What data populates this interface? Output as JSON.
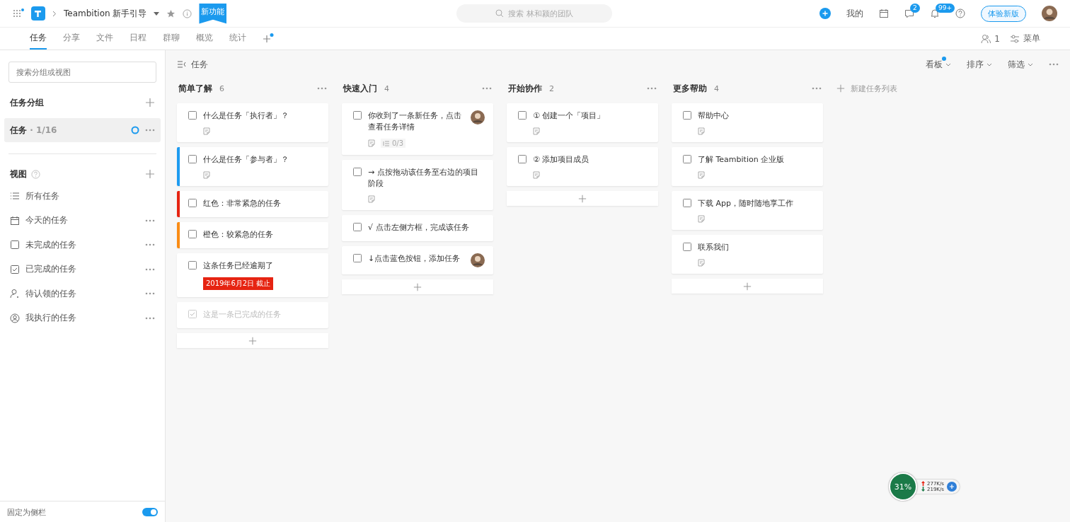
{
  "header": {
    "project_title": "Teambition 新手引导",
    "new_feature_badge": "新功能",
    "search_placeholder": "搜索 林和颍的团队",
    "mine_label": "我的",
    "chat_badge": "2",
    "notice_badge": "99+",
    "try_new_label": "体验新版"
  },
  "tabs": [
    {
      "label": "任务",
      "selected": true
    },
    {
      "label": "分享",
      "selected": false
    },
    {
      "label": "文件",
      "selected": false
    },
    {
      "label": "日程",
      "selected": false
    },
    {
      "label": "群聊",
      "selected": false
    },
    {
      "label": "概览",
      "selected": false
    },
    {
      "label": "统计",
      "selected": false
    }
  ],
  "members_count": "1",
  "menu_label": "菜单",
  "sidebar": {
    "search_placeholder": "搜索分组或视图",
    "groups_title": "任务分组",
    "groups": [
      {
        "label": "任务",
        "count": "· 1/16",
        "selected": true
      }
    ],
    "views_title": "视图",
    "views": [
      {
        "kind": "list",
        "label": "所有任务",
        "more": false
      },
      {
        "kind": "calendar",
        "label": "今天的任务",
        "more": true
      },
      {
        "kind": "box",
        "label": "未完成的任务",
        "more": true
      },
      {
        "kind": "checked",
        "label": "已完成的任务",
        "more": true
      },
      {
        "kind": "person",
        "label": "待认领的任务",
        "more": true
      },
      {
        "kind": "user",
        "label": "我执行的任务",
        "more": true
      }
    ],
    "pin_label": "固定为侧栏",
    "pin_on": true
  },
  "toolbar": {
    "breadcrumb": "任务",
    "options": [
      {
        "label": "看板",
        "dot": true
      },
      {
        "label": "排序",
        "dot": false
      },
      {
        "label": "筛选",
        "dot": false
      }
    ]
  },
  "columns": [
    {
      "title": "简单了解",
      "count": "6",
      "cards": [
        {
          "title": "什么是任务「执行者」？",
          "checked": false,
          "note": true,
          "avatar": false
        },
        {
          "title": "什么是任务「参与者」？",
          "color": "#1e9bf0",
          "checked": false,
          "note": true,
          "avatar": false
        },
        {
          "title": "红色：非常紧急的任务",
          "color": "#e62412",
          "checked": false,
          "note": false,
          "avatar": false
        },
        {
          "title": "橙色：较紧急的任务",
          "color": "#fa8c15",
          "checked": false,
          "note": false,
          "avatar": false
        },
        {
          "title": "这条任务已经逾期了",
          "checked": false,
          "note": false,
          "avatar": false,
          "due": "2019年6月2日 截止"
        },
        {
          "title": "这是一条已完成的任务",
          "checked": true,
          "note": false,
          "avatar": false
        }
      ]
    },
    {
      "title": "快速入门",
      "count": "4",
      "cards": [
        {
          "title": "你收到了一条新任务，点击查看任务详情",
          "checked": false,
          "note": true,
          "avatar": true,
          "subtasks": "0/3"
        },
        {
          "title": "→ 点按拖动该任务至右边的项目阶段",
          "checked": false,
          "note": true,
          "avatar": false
        },
        {
          "title": "√ 点击左侧方框，完成该任务",
          "checked": false,
          "note": false,
          "avatar": false
        },
        {
          "title": "↓点击蓝色按钮，添加任务",
          "checked": false,
          "note": false,
          "avatar": true
        }
      ]
    },
    {
      "title": "开始协作",
      "count": "2",
      "cards": [
        {
          "title": "① 创建一个「项目」",
          "checked": false,
          "note": true,
          "avatar": false
        },
        {
          "title": "② 添加项目成员",
          "checked": false,
          "note": true,
          "avatar": false
        }
      ]
    },
    {
      "title": "更多帮助",
      "count": "4",
      "cards": [
        {
          "title": "帮助中心",
          "checked": false,
          "note": true,
          "avatar": false
        },
        {
          "title": "了解 Teambition 企业版",
          "checked": false,
          "note": true,
          "avatar": false
        },
        {
          "title": "下载 App，随时随地享工作",
          "checked": false,
          "note": true,
          "avatar": false
        },
        {
          "title": "联系我们",
          "checked": false,
          "note": true,
          "avatar": false
        }
      ]
    }
  ],
  "new_list_label": "新建任务列表",
  "net_widget": {
    "percent": "31%",
    "upload": "277K/s",
    "download": "219K/s"
  }
}
